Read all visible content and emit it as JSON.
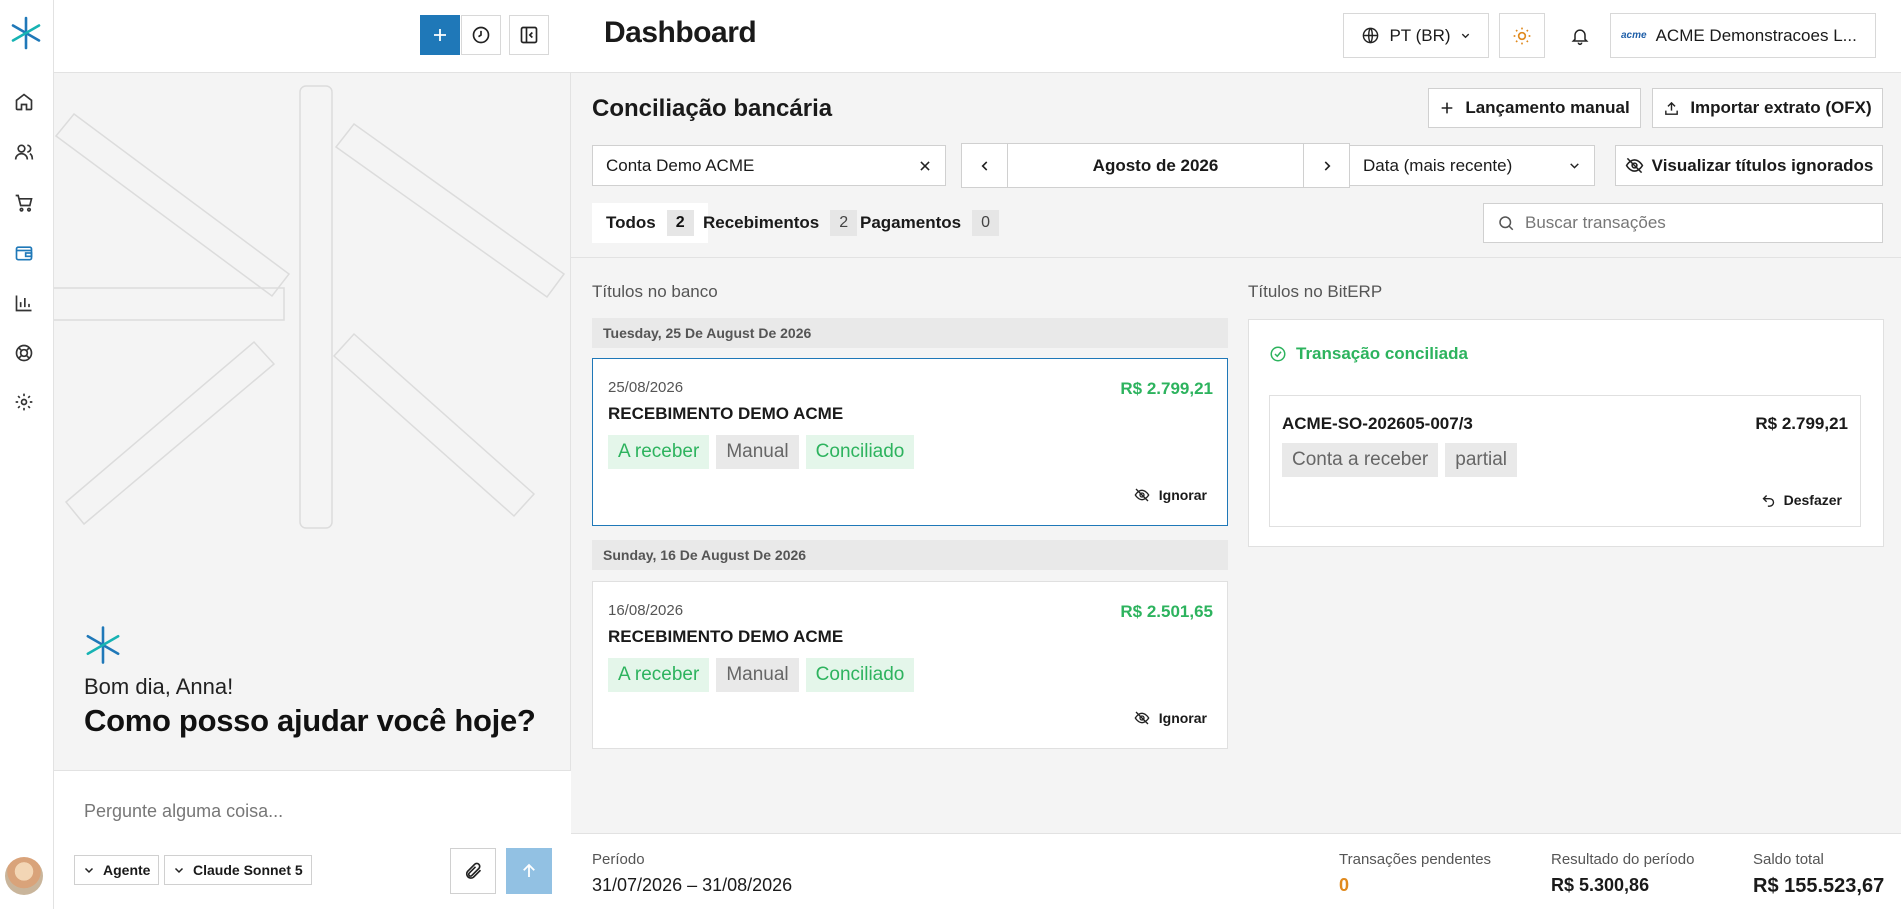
{
  "rail": {
    "items": [
      {
        "name": "home-icon"
      },
      {
        "name": "users-icon"
      },
      {
        "name": "cart-icon"
      },
      {
        "name": "wallet-icon"
      },
      {
        "name": "bar-chart-icon"
      },
      {
        "name": "lifebuoy-icon"
      },
      {
        "name": "gear-icon"
      }
    ],
    "active": "wallet-icon",
    "accent_color": "#1f78b8"
  },
  "chat": {
    "greeting": "Bom dia, Anna!",
    "question": "Como posso ajudar você hoje?",
    "input_placeholder": "Pergunte alguma coisa...",
    "mode_label": "Agente",
    "model_label": "Claude Sonnet 5"
  },
  "header": {
    "title": "Dashboard",
    "language": "PT (BR)",
    "company_logo": "acme",
    "company": "ACME Demonstracoes L..."
  },
  "reconciliation": {
    "title": "Conciliação bancária",
    "manual_entry_label": "Lançamento manual",
    "import_label": "Importar extrato (OFX)",
    "account": "Conta Demo ACME",
    "month": "Agosto de 2026",
    "sort": "Data (mais recente)",
    "ignored_label": "Visualizar títulos ignorados",
    "tabs": [
      {
        "label": "Todos",
        "count": "2"
      },
      {
        "label": "Recebimentos",
        "count": "2"
      },
      {
        "label": "Pagamentos",
        "count": "0"
      }
    ],
    "search_placeholder": "Buscar transações",
    "bank_column_title": "Títulos no banco",
    "erp_column_title": "Títulos no BitERP",
    "groups": [
      {
        "date_header": "Tuesday, 25 De August De 2026",
        "transaction": {
          "date": "25/08/2026",
          "amount": "R$ 2.799,21",
          "name": "RECEBIMENTO DEMO ACME",
          "chips": [
            "A receber",
            "Manual",
            "Conciliado"
          ],
          "ignore_label": "Ignorar"
        }
      },
      {
        "date_header": "Sunday, 16 De August De 2026",
        "transaction": {
          "date": "16/08/2026",
          "amount": "R$ 2.501,65",
          "name": "RECEBIMENTO DEMO ACME",
          "chips": [
            "A receber",
            "Manual",
            "Conciliado"
          ],
          "ignore_label": "Ignorar"
        }
      }
    ],
    "match": {
      "status": "Transação conciliada",
      "code": "ACME-SO-202605-007/3",
      "amount": "R$ 2.799,21",
      "chips": [
        "Conta a receber",
        "partial"
      ],
      "undo_label": "Desfazer"
    }
  },
  "footer": {
    "period_label": "Período",
    "period_value": "31/07/2026 – 31/08/2026",
    "pending_label": "Transações pendentes",
    "pending_value": "0",
    "result_label": "Resultado do período",
    "result_value": "R$ 5.300,86",
    "balance_label": "Saldo total",
    "balance_value": "R$ 155.523,67"
  },
  "colors": {
    "primary": "#1f78b8",
    "success": "#2db35e",
    "pending": "#e08a1e"
  }
}
